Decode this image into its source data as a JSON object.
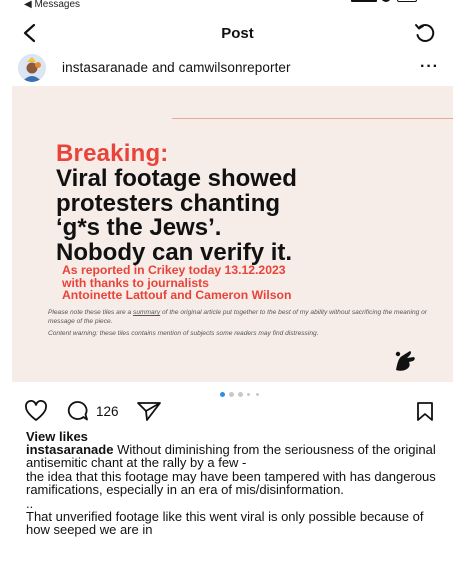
{
  "status_bar": {
    "back_label": "◀ Messages"
  },
  "nav": {
    "title": "Post"
  },
  "post": {
    "authors": "instasaranade and camwilsonreporter",
    "more": "···"
  },
  "tile": {
    "breaking": "Breaking:",
    "headline_lines": [
      "Viral footage showed",
      "protesters chanting",
      "‘g*s the Jews’.",
      "Nobody can verify it."
    ],
    "credit_lines": [
      "As reported in Crikey today 13.12.2023",
      "with thanks to journalists",
      "Antoinette Lattouf and Cameron Wilson"
    ],
    "note_pre": "Please note these tiles are a ",
    "note_link": "summary",
    "note_post": " of the original article put together to the best of my ability without sacrificing the meaning or message of the piece.",
    "warning": "Content warning: these tiles contains mention of subjects some readers may find distressing.",
    "accent_color": "#e8443a"
  },
  "carousel": {
    "total": 5,
    "active_index": 0
  },
  "actions": {
    "comment_count": "126"
  },
  "views_label": "View likes",
  "caption": {
    "username": "instasaranade",
    "lines": [
      "Without diminishing from the seriousness of the original antisemitic chant at the rally by a few -",
      "the idea that this footage may have been tampered with has dangerous ramifications, especially in an era of mis/disinformation.",
      "..",
      "That unverified footage like this went viral is only possible because of how seeped we are in"
    ]
  }
}
